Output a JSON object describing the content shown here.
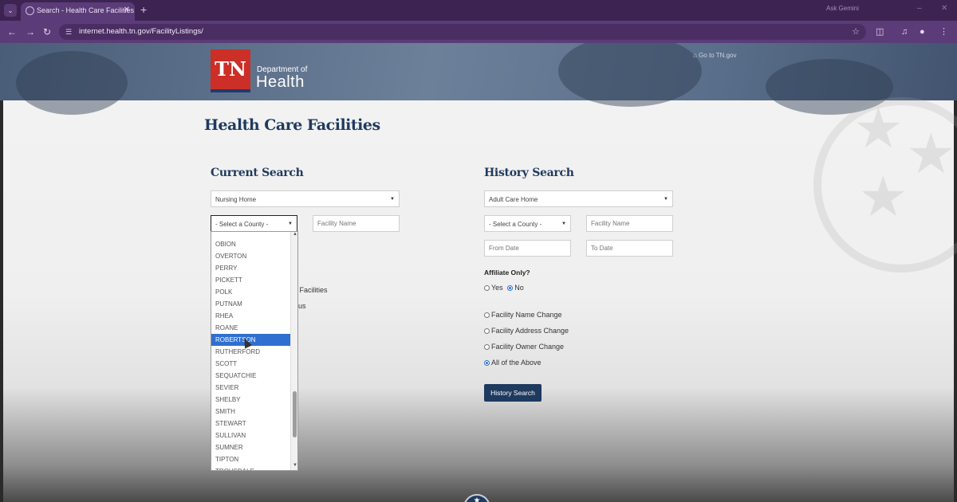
{
  "browser": {
    "tab_title": "Search - Health Care Facilities",
    "new_tab_glyph": "+",
    "url": "internet.health.tn.gov/FacilityListings/",
    "ask_gemini": "Ask Gemini",
    "theme_color": "#5b3c78"
  },
  "header": {
    "logo_mark": "TN",
    "logo_dept": "Department of",
    "logo_name": "Health",
    "go_link": "Go to TN.gov",
    "logo_color": "#cc2f27"
  },
  "page": {
    "title": "Health Care Facilities"
  },
  "current_search": {
    "title": "Current Search",
    "facility_type": "Nursing Home",
    "county": "- Select a County -",
    "facility_name_placeholder": "Facility Name",
    "occluded_label_1": "l Facilities",
    "occluded_label_2": "us",
    "county_options": [
      "OBION",
      "OVERTON",
      "PERRY",
      "PICKETT",
      "POLK",
      "PUTNAM",
      "RHEA",
      "ROANE",
      "ROBERTSON",
      "RUTHERFORD",
      "SCOTT",
      "SEQUATCHIE",
      "SEVIER",
      "SHELBY",
      "SMITH",
      "STEWART",
      "SULLIVAN",
      "SUMNER",
      "TIPTON",
      "TROUSDALE"
    ],
    "highlighted_option": "ROBERTSON"
  },
  "history_search": {
    "title": "History Search",
    "facility_type": "Adult Care Home",
    "county": "- Select a County -",
    "facility_name_placeholder": "Facility Name",
    "from_date_placeholder": "From Date",
    "to_date_placeholder": "To Date",
    "affiliate_label": "Affiliate Only?",
    "affiliate_yes": "Yes",
    "affiliate_no": "No",
    "affiliate_selected": "No",
    "change_options": [
      "Facility Name Change",
      "Facility Address Change",
      "Facility Owner Change",
      "All of the Above"
    ],
    "change_selected": "All of the Above",
    "button_label": "History Search",
    "button_color": "#1e3a5f"
  }
}
